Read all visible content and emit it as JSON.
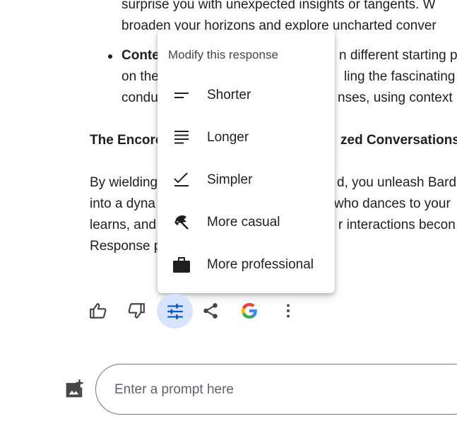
{
  "response": {
    "lines": [
      "surprise you with unexpected insights or tangents. W",
      "broaden your horizons and explore uncharted conver",
      "Conte",
      "n different starting p",
      "on the",
      "ling the fascinating",
      "condu",
      "nses, using context",
      "The Encore",
      "zed Conversations",
      "By wielding",
      "d, you unleash Bard's",
      "into a dyna",
      "who dances to your",
      "learns, and",
      "r interactions becon",
      "Response p"
    ]
  },
  "menu": {
    "title": "Modify this response",
    "items": [
      {
        "label": "Shorter",
        "icon": "short-text-icon"
      },
      {
        "label": "Longer",
        "icon": "long-text-icon"
      },
      {
        "label": "Simpler",
        "icon": "check-lines-icon"
      },
      {
        "label": "More casual",
        "icon": "beach-umbrella-icon"
      },
      {
        "label": "More professional",
        "icon": "briefcase-icon"
      }
    ]
  },
  "actions": [
    {
      "name": "thumbs-up-icon"
    },
    {
      "name": "thumbs-down-icon"
    },
    {
      "name": "tune-icon",
      "active": true
    },
    {
      "name": "share-icon"
    },
    {
      "name": "google-g-icon"
    },
    {
      "name": "more-vert-icon"
    }
  ],
  "prompt": {
    "placeholder": "Enter a prompt here"
  },
  "colors": {
    "active_bg": "#d8e4fb",
    "active_icon": "#0b57d0",
    "text": "#1f1f1f",
    "menu_title": "#444746"
  }
}
